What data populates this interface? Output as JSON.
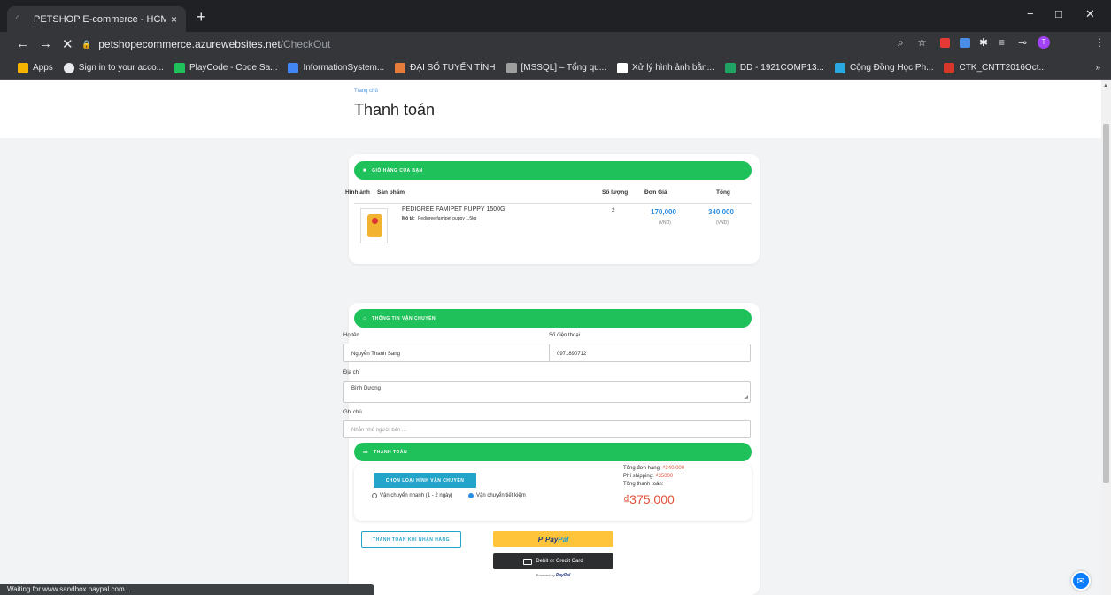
{
  "browser": {
    "tab_title": "PETSHOP E-commerce - HCMUE",
    "tab_close": "×",
    "new_tab": "+",
    "url_host": "petshopecommerce.azurewebsites.net",
    "url_path": "/CheckOut",
    "window_controls": [
      "−",
      "□",
      "✕"
    ],
    "bookmarks": [
      {
        "label": "Apps",
        "color": "#f4b400"
      },
      {
        "label": "Sign in to your acco...",
        "color": "#e8eaed"
      },
      {
        "label": "PlayCode - Code Sa...",
        "color": "#1fc15a"
      },
      {
        "label": "InformationSystem...",
        "color": "#4285f4"
      },
      {
        "label": "ĐẠI SỐ TUYẾN TÍNH",
        "color": "#e67c3a"
      },
      {
        "label": "[MSSQL] – Tổng qu...",
        "color": "#9e9e9e"
      },
      {
        "label": "Xử lý hình ảnh bằn...",
        "color": "#ffffff"
      },
      {
        "label": "DD - 1921COMP13...",
        "color": "#1fa463"
      },
      {
        "label": "Cộng Đồng Học Ph...",
        "color": "#2aa7e0"
      },
      {
        "label": "CTK_CNTT2016Oct...",
        "color": "#d9362b"
      }
    ],
    "bookmarks_more": "»",
    "status_text": "Waiting for www.sandbox.paypal.com..."
  },
  "header": {
    "breadcrumb": "Trang chủ",
    "title": "Thanh toán"
  },
  "cart": {
    "bar_label": "GIỎ HÀNG CỦA BẠN",
    "columns": [
      "Hình ảnh",
      "Sản phẩm",
      "Số lượng",
      "Đơn Giá",
      "Tổng"
    ],
    "row": {
      "product_name": "PEDIGREE FAMIPET PUPPY 1500G",
      "note_label": "Mô tả:",
      "note_value": "Pedigree famipet puppy 1,5kg",
      "quantity": "2",
      "unit_price": "170,000",
      "total": "340,000",
      "currency": "(VND)"
    }
  },
  "shipping": {
    "bar_label": "THÔNG TIN VẬN CHUYỂN",
    "name_label": "Họ tên",
    "name_value": "Nguyễn Thanh Sang",
    "phone_label": "Số điện thoại",
    "phone_value": "0971890712",
    "address_label": "Địa chỉ",
    "address_value": "Bình Dương",
    "note_label": "Ghi chú",
    "note_placeholder": "Nhắn nhủ người bán ..."
  },
  "payment": {
    "bar_label": "THANH TOÁN",
    "choose_button": "CHỌN LOẠI HÌNH VẬN CHUYỂN",
    "option_fast": "Vận chuyển nhanh (1 - 2 ngày)",
    "option_saving": "Vận chuyển tiết kiệm",
    "order_total_label": "Tổng đơn hàng:",
    "order_total_value": "₫340.000",
    "shipping_fee_label": "Phí shipping:",
    "shipping_fee_value": "₫35000",
    "grand_total_label": "Tổng thanh toán:",
    "grand_total_value": "₫375.000",
    "cod_button": "THANH TOÁN KHI NHẬN HÀNG",
    "paypal_pay": "Pay",
    "paypal_pal": "Pal",
    "card_button": "Debit or Credit Card",
    "powered_by": "Powered by",
    "powered_brand": "PayPal"
  },
  "colors": {
    "accent_green": "#1fc15a",
    "accent_blue": "#22a5c8",
    "price_blue": "#2b8de0",
    "total_red": "#e0523a"
  }
}
